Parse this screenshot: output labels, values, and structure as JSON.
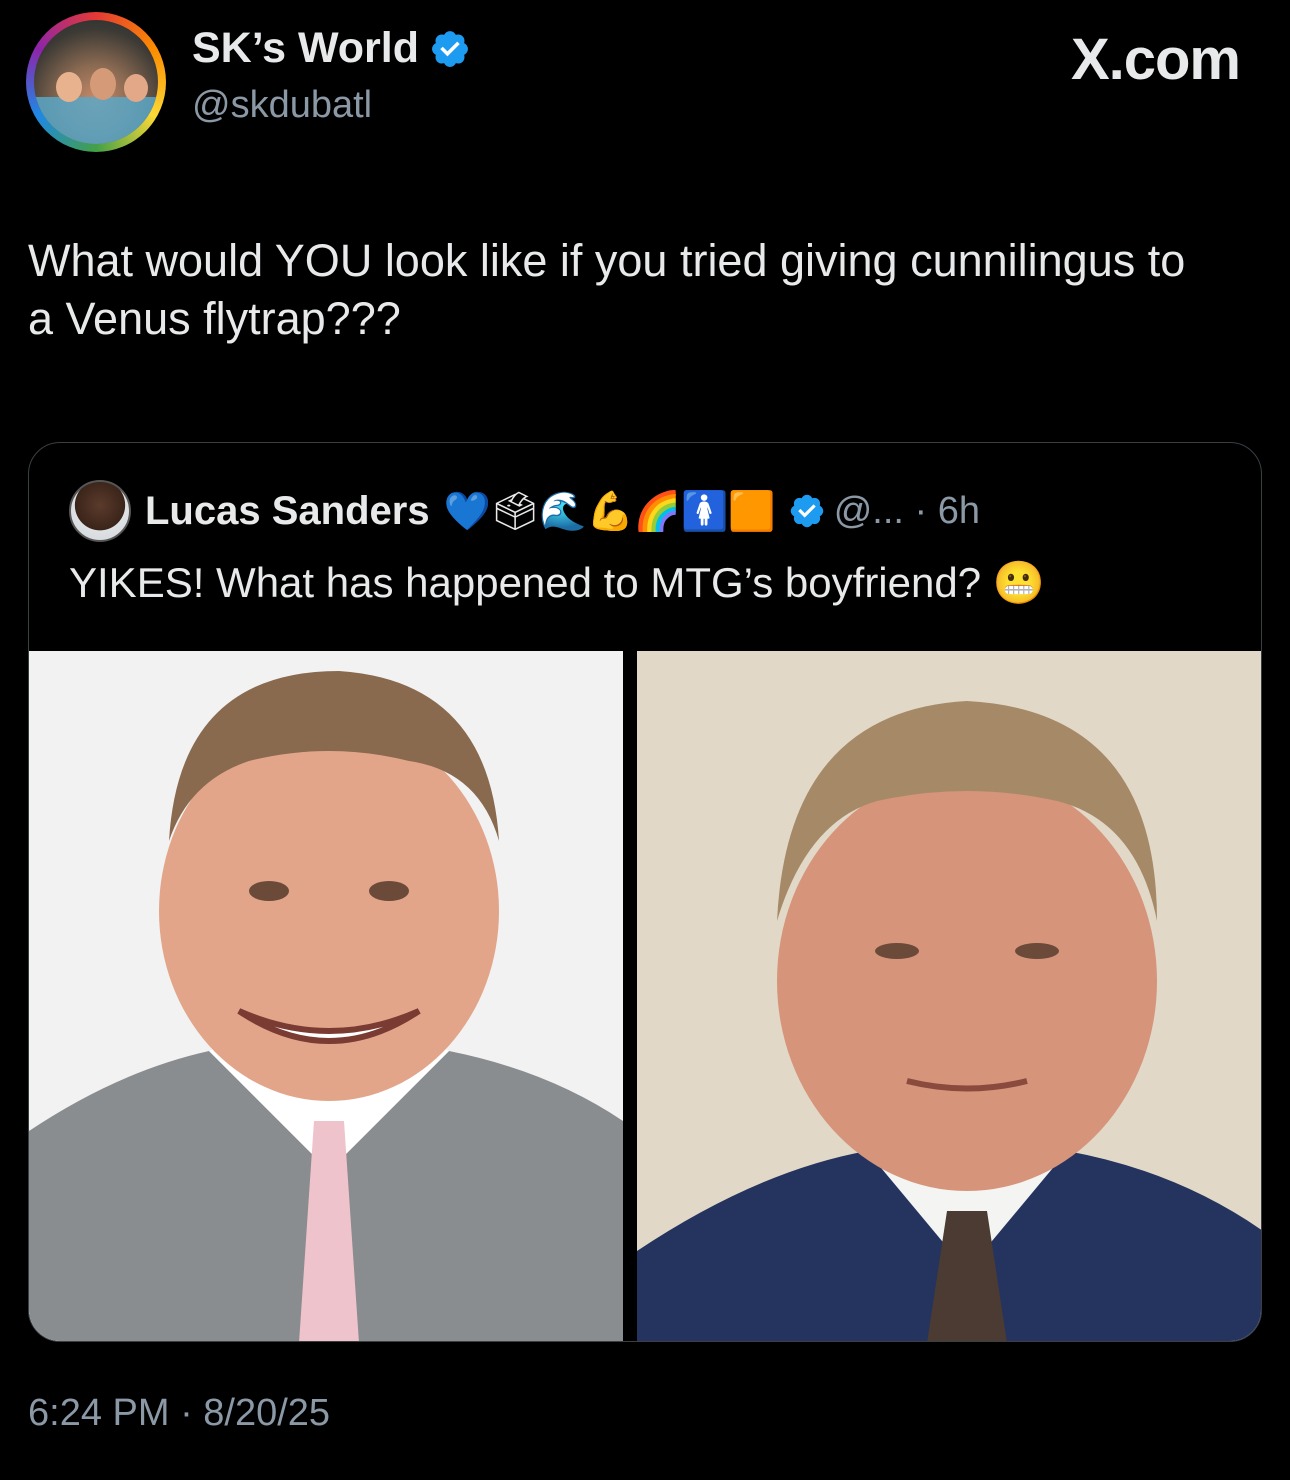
{
  "author": {
    "name": "SK’s World",
    "handle": "@skdubatl",
    "verified": true
  },
  "site_label": "X.com",
  "tweet": {
    "text": "What would YOU look like if you tried giving cunnilingus to a Venus flytrap???",
    "timestamp": "6:24 PM · 8/20/25"
  },
  "quoted_tweet": {
    "author_name": "Lucas Sanders",
    "name_emojis": "💙🗳🌊💪🌈🚺🟧",
    "verified": true,
    "handle_time": "@... · 6h",
    "text": "YIKES! What has happened to MTG’s boyfriend? 😬",
    "photos": [
      "left-photo-smiling-man-gray-suit",
      "right-photo-man-navy-suit"
    ]
  },
  "colors": {
    "background": "#000000",
    "text_primary": "#e7e9ea",
    "text_secondary": "#8b98a5",
    "verified_blue": "#1d9bf0",
    "border": "#3a3f44"
  }
}
